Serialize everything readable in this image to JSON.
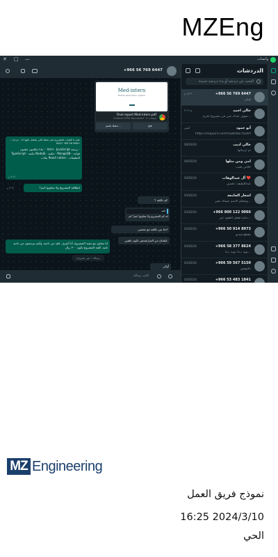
{
  "header": {
    "title": "MZEng"
  },
  "window": {
    "app_name": "واتساب",
    "controls": [
      "✕",
      "□",
      "—"
    ]
  },
  "chat_list": {
    "title": "الدردشات",
    "search_placeholder": "البحث عن دردشة أو بدء دردشة جديدة",
    "items": [
      {
        "name": "+966 56 769 6447",
        "preview": "أوكي",
        "time": "٨:٣٦ م"
      },
      {
        "name": "خالي احمد",
        "preview": "شوف عندك شي في مشروع تخرج...",
        "time": "م ٣:١٩"
      },
      {
        "name": "أبو حمود",
        "preview": "https://arquora.com/%D8%B7%D9%8...",
        "time": "أمس"
      },
      {
        "name": "خالي ادبب",
        "preview": "تم ارسالها",
        "time": "04/03/24"
      },
      {
        "name": "امي ومن مثلها",
        "preview": "خلاص طيب",
        "time": "04/03/24"
      },
      {
        "name": "آل عبدالوهاب ❤️",
        "preview": "عبداللطيف: ملصق",
        "time": "04/03/24"
      },
      {
        "name": "اشعار الجامعة",
        "preview": "وشلكم الاسم عساك بخير...",
        "time": "03/03/24"
      },
      {
        "name": "+966 800 122 0066",
        "preview": "بداية تفعيل العقود عبر...",
        "time": "03/03/24"
      },
      {
        "name": "+966 50 914 8973",
        "preview": "مقطع فيديو",
        "time": "03/03/24"
      },
      {
        "name": "+966 58 377 8624",
        "preview": "نوبه ب5 نوبه ب5...",
        "time": "03/03/24"
      },
      {
        "name": "+966 59 567 5150",
        "preview": "بالتوفيق",
        "time": "03/03/24"
      },
      {
        "name": "+966 53 483 1841",
        "preview": "",
        "time": "03/03/24"
      }
    ]
  },
  "conversation": {
    "contact": "+966 56 769 6447",
    "document": {
      "preview_title": "Med-intern",
      "preview_subtitle": "Mobile application system",
      "file_name": "Final report Med-intern.pdf",
      "file_meta": "Chrome HTML Document · 9 صفحات",
      "open_label": "فتح",
      "save_label": "حفظ باسم..."
    },
    "messages": [
      {
        "dir": "out",
        "text": "عليه يا الشباب المشروع تبغى تعمله اللي يشتغل عليها انا .. مرحبا ... +966 56 769 6447",
        "extra": "ماذا تتكلمون تعلمون: - html - JavaScript برمجة - TypeScript - مكتبة NodeJS - مكتبة - MongoDB - قواعد بيانات React native - التطبيقات",
        "time": "٩:١٢ م"
      },
      {
        "dir": "out",
        "text": "انطلاقة المشروع ولا تتعاونوا انتم؟",
        "time": "٩:١٢ م"
      },
      {
        "dir": "in",
        "text": "كم تكلفة ؟",
        "time": "٩:٢٢ م"
      },
      {
        "dir": "in",
        "text": "انه كم المشروع ولا تتعاونوا انتم؟ كم",
        "quote": "انتم",
        "time": "٩:٢٢ م"
      },
      {
        "dir": "in",
        "text": "احتا نبي تكلفة مع بعضتي",
        "time": "٩:٢٤ م"
      },
      {
        "dir": "in",
        "text": "علشان من المزايشنش تكون ياهبين",
        "time": "٩:٢٤ م"
      },
      {
        "dir": "out",
        "text": "انا نتعاون مع تنفيذ المشروع، أنا أشرف عليه من ناحية، وأنتم تبرمجون من ناحية ثانية، كلفة المشروع تكون ٣٠٠ ريال",
        "time": "٩:٢٥ م"
      },
      {
        "dir": "in",
        "text": "أوكي",
        "time": "٩:٣٦ م"
      }
    ],
    "unread_label": "رسالة ١ غير مقروءة",
    "composer_placeholder": "اكتب رسالة"
  },
  "footer": {
    "logo_mark": "MZ",
    "logo_word": "Engineering",
    "line1": "نموذج فريق العمل",
    "line2": "16:25 2024/3/10",
    "line3": "الحي"
  }
}
